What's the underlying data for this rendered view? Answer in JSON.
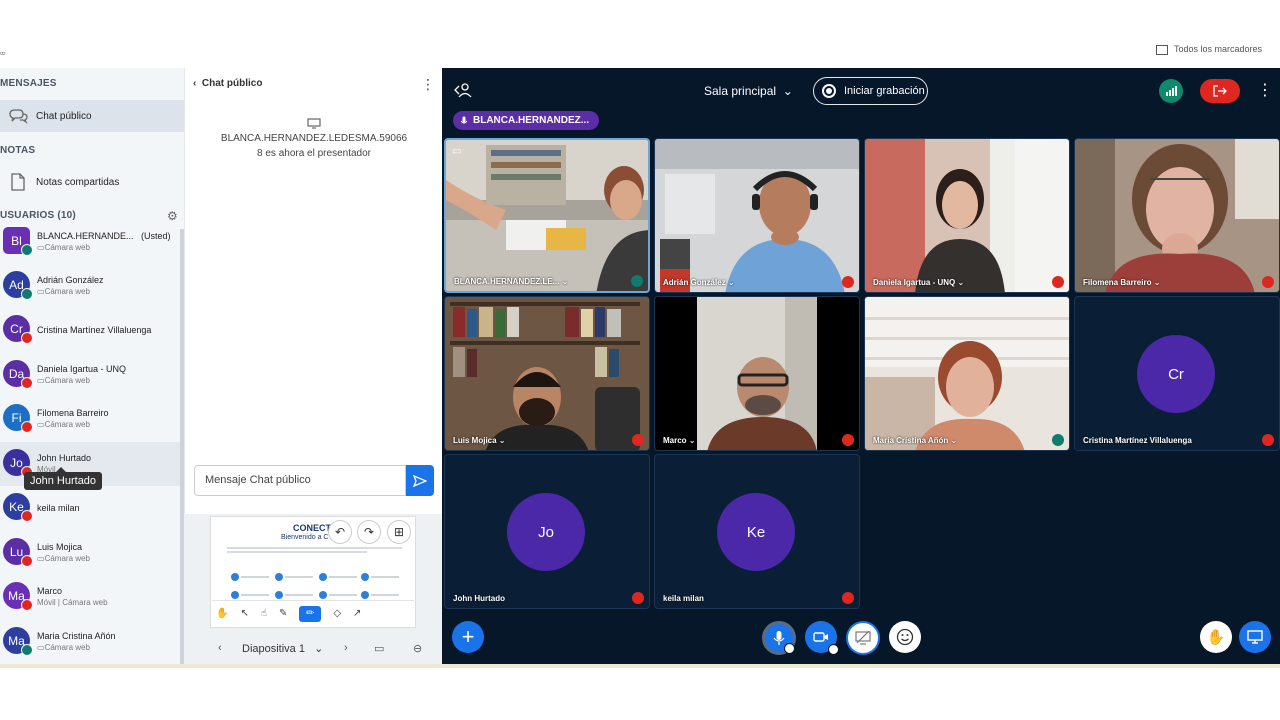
{
  "browser": {
    "bookmarks_label": "Todos los marcadores"
  },
  "sidebar": {
    "messages_title": "MENSAJES",
    "public_chat": "Chat público",
    "notes_title": "NOTAS",
    "shared_notes": "Notas compartidas",
    "users_title": "USUARIOS (10)",
    "users": [
      {
        "initials": "Bl",
        "name": "BLANCA.HERNANDE...",
        "tag": "(Usted)",
        "sub": "Cámara web",
        "color": "#6b2fb5",
        "status": "teal",
        "square": true
      },
      {
        "initials": "Ad",
        "name": "Adrián González",
        "tag": "",
        "sub": "Cámara web",
        "color": "#2c3e9f",
        "status": "teal",
        "square": false
      },
      {
        "initials": "Cr",
        "name": "Cristina Martínez Villaluenga",
        "tag": "",
        "sub": "",
        "color": "#5b2ea6",
        "status": "red",
        "square": false
      },
      {
        "initials": "Da",
        "name": "Daniela Igartua - UNQ",
        "tag": "",
        "sub": "Cámara web",
        "color": "#5b2ea6",
        "status": "red",
        "square": false
      },
      {
        "initials": "Fi",
        "name": "Filomena Barreiro",
        "tag": "",
        "sub": "Cámara web",
        "color": "#1c6fc4",
        "status": "red",
        "square": false
      },
      {
        "initials": "Jo",
        "name": "John Hurtado",
        "tag": "",
        "sub": "Móvil",
        "color": "#3b2fa0",
        "status": "red",
        "square": false
      },
      {
        "initials": "Ke",
        "name": "keila milan",
        "tag": "",
        "sub": "",
        "color": "#2c3e9f",
        "status": "red",
        "square": false
      },
      {
        "initials": "Lu",
        "name": "Luis Mojica",
        "tag": "",
        "sub": "Cámara web",
        "color": "#5b2ea6",
        "status": "red",
        "square": false
      },
      {
        "initials": "Ma",
        "name": "Marco",
        "tag": "",
        "sub": "Móvil | Cámara web",
        "color": "#6b2fb5",
        "status": "red",
        "square": false
      },
      {
        "initials": "Ma",
        "name": "Maria Cristina Añón",
        "tag": "",
        "sub": "Cámara web",
        "color": "#2c3e9f",
        "status": "teal",
        "square": false
      }
    ],
    "tooltip": "John Hurtado"
  },
  "chat": {
    "title": "Chat público",
    "system_line1": "BLANCA.HERNANDEZ.LEDESMA.59066",
    "system_line2": "8 es ahora el presentador",
    "input_placeholder": "Mensaje Chat público"
  },
  "presentation": {
    "slide_title": "CONECT",
    "slide_subtitle": "Bienvenido a C",
    "slide_label": "Diapositiva 1"
  },
  "meeting": {
    "room": "Sala principal",
    "record_label": "Iniciar grabación",
    "presenter": "BLANCA.HERNANDEZ...",
    "tiles": [
      {
        "name": "BLANCA.HERNANDEZ.LE...",
        "mic": "teal",
        "video": "office"
      },
      {
        "name": "Adrián González",
        "mic": "red",
        "video": "headset"
      },
      {
        "name": "Daniela Igartua - UNQ",
        "mic": "red",
        "video": "lab"
      },
      {
        "name": "Filomena Barreiro",
        "mic": "red",
        "video": "woman"
      },
      {
        "name": "Luis Mojica",
        "mic": "red",
        "video": "shelf"
      },
      {
        "name": "Marco",
        "mic": "red",
        "video": "marco"
      },
      {
        "name": "Maria Cristina Añón",
        "mic": "teal",
        "video": "window"
      },
      {
        "name": "Cristina Martínez Villaluenga",
        "mic": "red",
        "initials": "Cr"
      },
      {
        "name": "John Hurtado",
        "mic": "red",
        "initials": "Jo"
      },
      {
        "name": "keila milan",
        "mic": "red",
        "initials": "Ke"
      }
    ]
  },
  "colors": {
    "accent": "#1a73e8",
    "danger": "#df2721",
    "meeting_bg": "#06172a",
    "avatar_purple": "#4a28a8"
  }
}
